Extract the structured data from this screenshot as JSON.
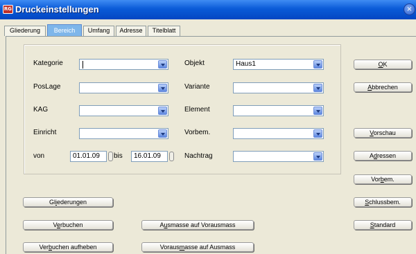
{
  "window": {
    "title": "Druckeinstellungen",
    "app_icon_text": "RG",
    "close_symbol": "×"
  },
  "tabs": [
    {
      "label": "Gliederung",
      "active": false
    },
    {
      "label": "Bereich",
      "active": true
    },
    {
      "label": "Umfang",
      "active": false
    },
    {
      "label": "Adresse",
      "active": false
    },
    {
      "label": "Titelblatt",
      "active": false
    }
  ],
  "fields": {
    "kategorie": {
      "label": "Kategorie",
      "value": ""
    },
    "poslage": {
      "label": "PosLage",
      "value": ""
    },
    "kag": {
      "label": "KAG",
      "value": ""
    },
    "einricht": {
      "label": "Einricht",
      "value": ""
    },
    "objekt": {
      "label": "Objekt",
      "value": "Haus1"
    },
    "variante": {
      "label": "Variante",
      "value": ""
    },
    "element": {
      "label": "Element",
      "value": ""
    },
    "vorbem": {
      "label": "Vorbem.",
      "value": ""
    },
    "nachtrag": {
      "label": "Nachtrag",
      "value": ""
    },
    "von": {
      "label": "von",
      "value": "01.01.09"
    },
    "bis": {
      "label": "bis",
      "value": "16.01.09"
    }
  },
  "buttons": {
    "ok": {
      "pre": "",
      "u": "O",
      "post": "K"
    },
    "abbrechen": {
      "pre": "",
      "u": "A",
      "post": "bbrechen"
    },
    "vorschau": {
      "pre": "",
      "u": "V",
      "post": "orschau"
    },
    "adressen": {
      "pre": "A",
      "u": "d",
      "post": "ressen"
    },
    "vorbem": {
      "pre": "Vor",
      "u": "b",
      "post": "em."
    },
    "schlussbem": {
      "pre": "",
      "u": "S",
      "post": "chlussbem."
    },
    "standard": {
      "pre": "",
      "u": "S",
      "post": "tandard"
    },
    "gliederungen": {
      "pre": "Gl",
      "u": "i",
      "post": "ederungen"
    },
    "verbuchen": {
      "pre": "V",
      "u": "e",
      "post": "rbuchen"
    },
    "verbuchen_aufheben": {
      "pre": "Ver",
      "u": "b",
      "post": "uchen aufheben"
    },
    "ausmasse_auf_vorausmass": {
      "pre": "A",
      "u": "u",
      "post": "smasse auf Vorausmass"
    },
    "vorausmasse_auf_ausmass": {
      "pre": "Voraus",
      "u": "m",
      "post": "asse auf Ausmass"
    }
  },
  "colors": {
    "titlebar": "#0a5bd8",
    "active_tab": "#7eb6ea",
    "dialog_bg": "#ece9d8"
  }
}
